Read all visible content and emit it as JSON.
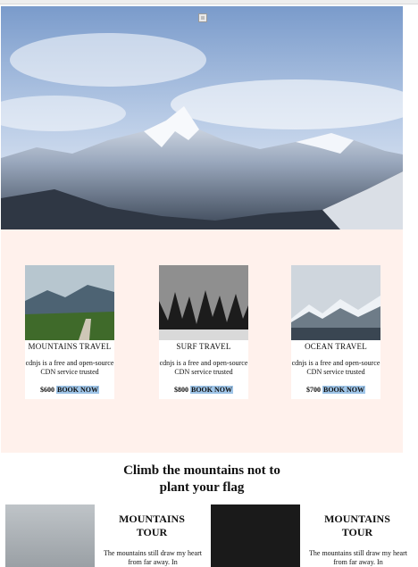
{
  "hero": {
    "icon": "image-placeholder-icon"
  },
  "offers": [
    {
      "title": "MOUNTAINS TRAVEL",
      "desc": "cdnjs is a free and open-source CDN service trusted",
      "price": "$600",
      "cta": "BOOK NOW"
    },
    {
      "title": "SURF TRAVEL",
      "desc": "cdnjs is a free and open-source CDN service trusted",
      "price": "$800",
      "cta": "BOOK NOW"
    },
    {
      "title": "OCEAN TRAVEL",
      "desc": "cdnjs is a free and open-source CDN service trusted",
      "price": "$700",
      "cta": "BOOK NOW"
    }
  ],
  "headline": "Climb the mountains not to plant your flag",
  "tours": [
    {
      "title": "MOUNTAINS TOUR",
      "text": "The mountains still draw my heart from far away. In"
    },
    {
      "title": "MOUNTAINS TOUR",
      "text": "The mountains still draw my heart from far away. In"
    }
  ],
  "colors": {
    "offers_bg": "#fff1ec",
    "book_highlight": "#9fc5e8"
  }
}
